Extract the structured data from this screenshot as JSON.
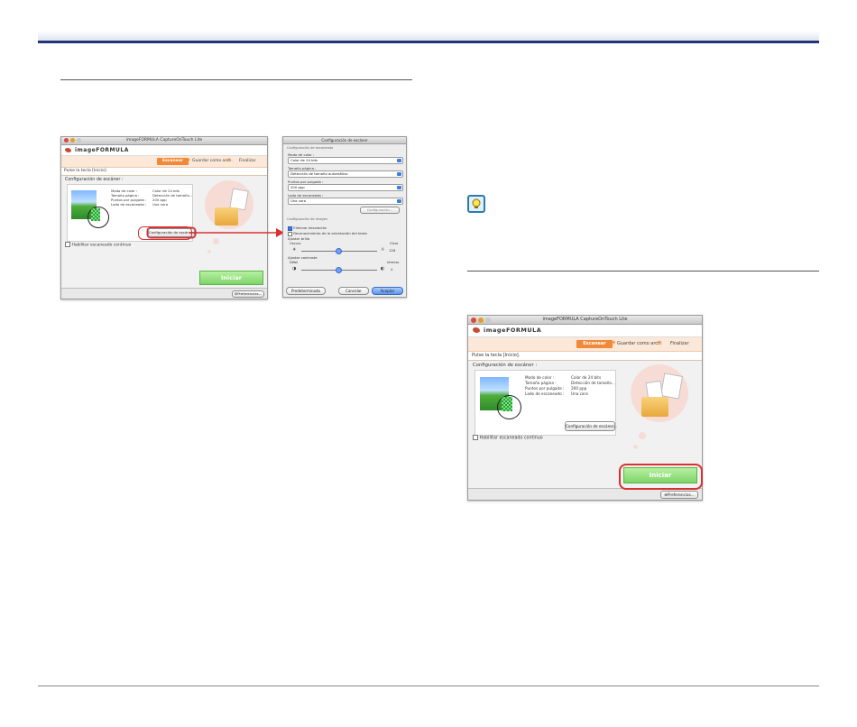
{
  "app": {
    "window_title": "imageFORMULA CaptureOnTouch Lite",
    "brand": "imageFORMULA",
    "steps": {
      "scan": "Escanear",
      "save": "Guardar como arch.",
      "finish": "Finalizar"
    },
    "prompt": "Pulse la tecla [Inicio].",
    "scan_settings_title": "Configuración de escáner :",
    "settings": [
      {
        "label": "Modo de color :",
        "value": "Color de 24 bits"
      },
      {
        "label": "Tamaño página :",
        "value": "Detección de tamaño..."
      },
      {
        "label": "Puntos por pulgada :",
        "value": "200 ppp"
      },
      {
        "label": "Lado de escaneado :",
        "value": "Una cara"
      }
    ],
    "config_button": "Configuración de escáner...",
    "continuous_scan": "Habilitar escaneado continuo",
    "start_button": "Iniciar",
    "preferences_button": "Preferencias..."
  },
  "dialog": {
    "title": "Configuración de escáner",
    "scanner_section": "Configuración de escaneado",
    "color_mode_label": "Modo de color :",
    "color_mode_value": "Color de 24 bits",
    "page_size_label": "Tamaño página :",
    "page_size_value": "Detección de tamaño automático",
    "dpi_label": "Puntos por pulgada :",
    "dpi_value": "200 ppp",
    "side_label": "Lado de escaneado :",
    "side_value": "Una cara",
    "side_config_button": "Configuración...",
    "image_section": "Configuración de imagen",
    "deskew": "Eliminar desviación",
    "text_orientation": "Reconocimiento de la orientación del texto",
    "brightness_label": "Ajustar brillo",
    "brightness_min": "Oscuro",
    "brightness_max": "Claro",
    "brightness_value": "128",
    "contrast_label": "Ajustar contraste",
    "contrast_min": "Débil",
    "contrast_max": "Intenso",
    "contrast_value": "4",
    "btn_default": "Predeterminado",
    "btn_cancel": "Cancelar",
    "btn_accept": "Aceptar"
  }
}
